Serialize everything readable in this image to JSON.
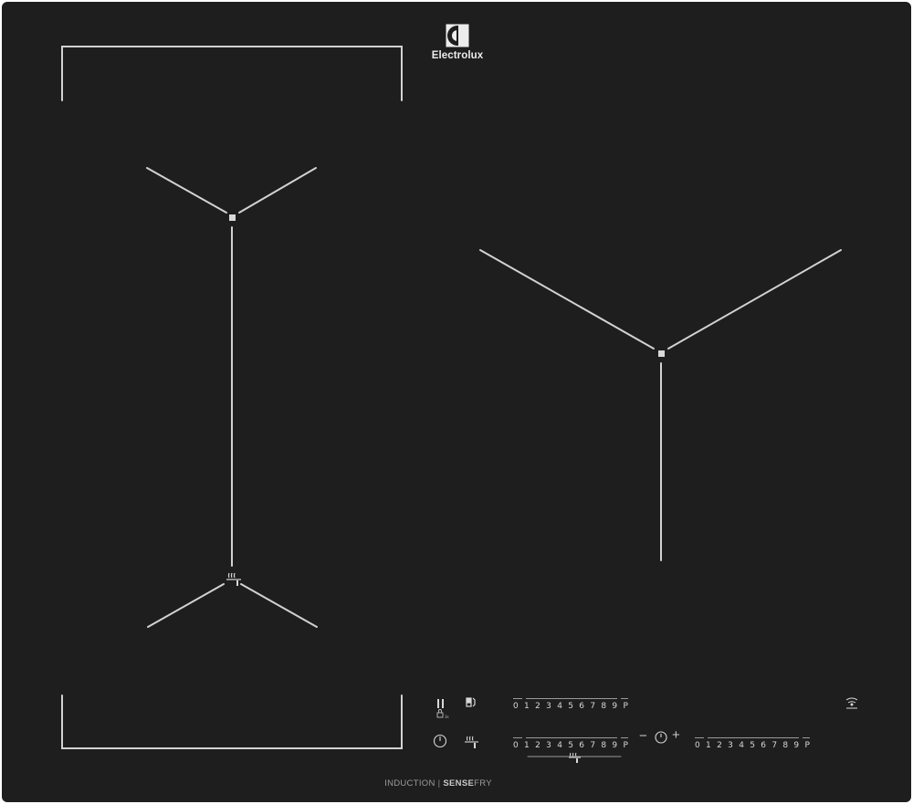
{
  "brand": {
    "name": "Electrolux"
  },
  "footer": {
    "tech1": "INDUCTION",
    "divider": "|",
    "tech2_bold": "SENSE",
    "tech2_rest": "FRY"
  },
  "icons": {
    "logo": "electrolux-logo-icon",
    "pause": "pause-icon",
    "lock": "lock-icon",
    "bridge": "bridge-zone-icon",
    "power": "power-icon",
    "sensefry_control": "sensefry-temperature-icon",
    "sensefry_zone": "sensefry-zone-icon",
    "sensefry_slider": "sensefry-slider-icon",
    "hob2hood": "hob2hood-wifi-icon",
    "timer": "timer-icon"
  },
  "sliders": {
    "levels": [
      "0",
      "1",
      "2",
      "3",
      "4",
      "5",
      "6",
      "7",
      "8",
      "9",
      "P"
    ]
  },
  "timer": {
    "minus": "−",
    "plus": "+"
  },
  "colors": {
    "glass": "#1e1e1e",
    "marking": "#d4d4d4",
    "text": "#d8d8d8"
  }
}
